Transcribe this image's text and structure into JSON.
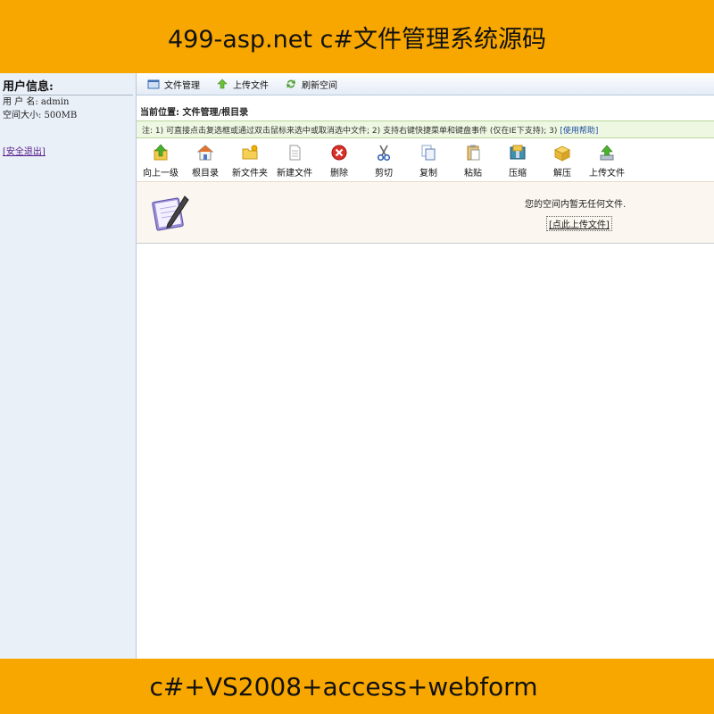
{
  "banner": {
    "top_text": "499-asp.net c#文件管理系统源码",
    "bottom_text": "c#+VS2008+access+webform"
  },
  "sidebar": {
    "title": "用户信息:",
    "username_line": "用 户 名: admin",
    "space_line": "空间大小: 500MB",
    "logout_label": "[安全退出]"
  },
  "topmenu": {
    "items": [
      {
        "label": "文件管理",
        "icon": "folder-window-icon"
      },
      {
        "label": "上传文件",
        "icon": "upload-arrow-icon"
      },
      {
        "label": "刷新空间",
        "icon": "refresh-icon"
      }
    ]
  },
  "location": {
    "text": "当前位置: 文件管理/根目录"
  },
  "note": {
    "text": "注: 1) 可直接点击复选框或通过双击鼠标来选中或取消选中文件; 2) 支持右键快捷菜单和键盘事件 (仅在IE下支持); 3)",
    "help_label": "[使用帮助]"
  },
  "toolbar": {
    "tools": [
      {
        "label": "向上一级",
        "icon": "up-level-icon"
      },
      {
        "label": "根目录",
        "icon": "home-icon"
      },
      {
        "label": "新文件夹",
        "icon": "new-folder-icon"
      },
      {
        "label": "新建文件",
        "icon": "new-file-icon"
      },
      {
        "label": "删除",
        "icon": "delete-icon"
      },
      {
        "label": "剪切",
        "icon": "scissors-icon"
      },
      {
        "label": "复制",
        "icon": "copy-icon"
      },
      {
        "label": "粘贴",
        "icon": "paste-icon"
      },
      {
        "label": "压缩",
        "icon": "compress-icon"
      },
      {
        "label": "解压",
        "icon": "extract-icon"
      },
      {
        "label": "上传文件",
        "icon": "upload-icon"
      }
    ]
  },
  "empty": {
    "message": "您的空间内暂无任何文件.",
    "upload_link": "[点此上传文件]"
  },
  "colors": {
    "banner": "#f7a700",
    "sidebar_bg": "#eaf0f8",
    "note_bg": "#eef7e2",
    "empty_bg": "#fbf6ef"
  }
}
